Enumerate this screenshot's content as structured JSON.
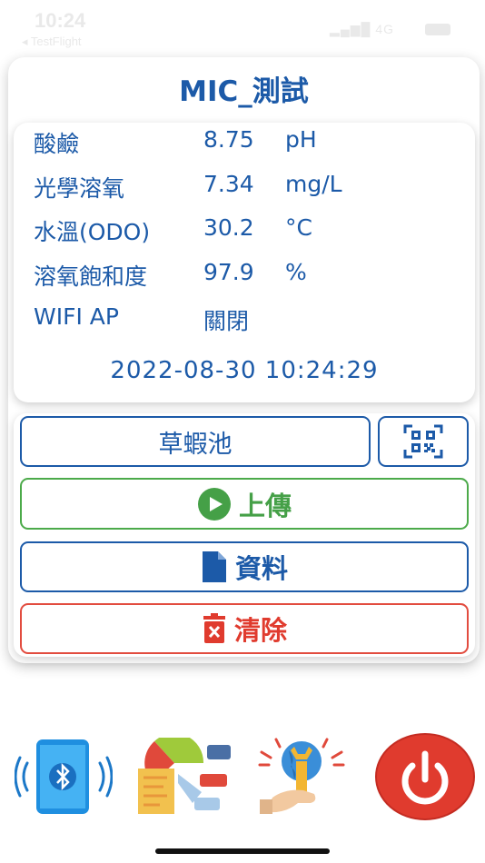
{
  "status_bar": {
    "time": "10:24",
    "back_label": "◂ TestFlight",
    "network": "4G"
  },
  "device": {
    "title": "MIC_測試"
  },
  "readings": [
    {
      "label": "酸鹼",
      "value": "8.75",
      "unit": "pH"
    },
    {
      "label": "光學溶氧",
      "value": "7.34",
      "unit": "mg/L"
    },
    {
      "label": "水溫(ODO)",
      "value": "30.2",
      "unit": "°C"
    },
    {
      "label": "溶氧飽和度",
      "value": "97.9",
      "unit": "%"
    },
    {
      "label": "WIFI AP",
      "value": "關閉",
      "unit": ""
    }
  ],
  "timestamp": "2022-08-30 10:24:29",
  "actions": {
    "pond_name": "草蝦池",
    "upload_label": "上傳",
    "data_label": "資料",
    "clear_label": "清除"
  },
  "colors": {
    "primary": "#1c5aa8",
    "upload": "#45a047",
    "clear": "#e03b2e"
  },
  "icons": {
    "qr": "qr-code-icon",
    "upload": "play-circle-icon",
    "data": "document-icon",
    "clear": "trash-icon",
    "bottom": [
      "bluetooth-phone-icon",
      "report-charts-icon",
      "settings-wrench-globe-icon",
      "power-icon"
    ]
  }
}
